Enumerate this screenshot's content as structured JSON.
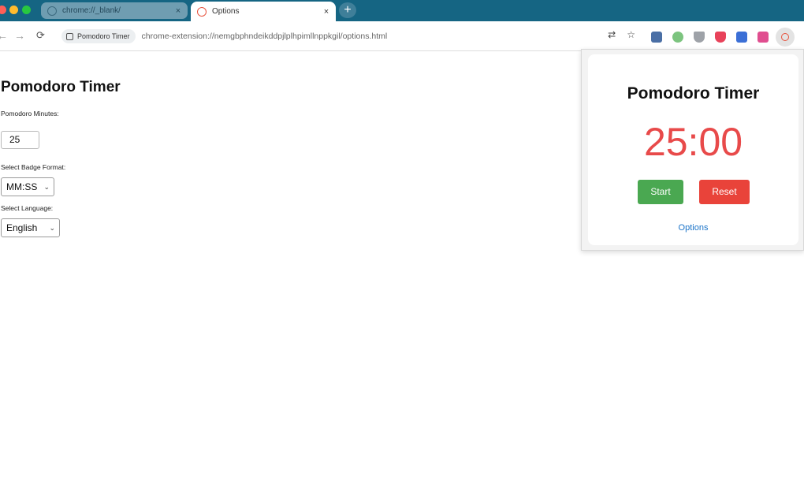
{
  "browser": {
    "tabs": [
      {
        "title": "chrome://_blank/",
        "active": false
      },
      {
        "title": "Options",
        "active": true
      }
    ],
    "new_tab": "+",
    "close_glyph": "×",
    "nav": {
      "back": "←",
      "forward": "→",
      "reload": "⟳"
    },
    "address": {
      "chip_label": "Pomodoro Timer",
      "url": "chrome-extension://nemgbphndeikddpjlplhpimllnppkgil/options.html"
    },
    "omnibox_icons": {
      "translate": "⇄",
      "bookmark": "☆"
    },
    "extension_icon_colors": [
      "#4a6fa5",
      "#7cc47f",
      "#9ea2a8",
      "#e8425a",
      "#3b6fd6",
      "#e04e8f"
    ]
  },
  "options_page": {
    "title": "Pomodoro Timer",
    "minutes_label": "Pomodoro Minutes:",
    "minutes_value": "25",
    "badge_format_label": "Select Badge Format:",
    "badge_format_value": "MM:SS",
    "language_label": "Select Language:",
    "language_value": "English",
    "caret": "⌄"
  },
  "popup": {
    "title": "Pomodoro Timer",
    "timer": "25:00",
    "start_label": "Start",
    "reset_label": "Reset",
    "options_link": "Options",
    "colors": {
      "timer": "#e84a4a",
      "start": "#4aa851",
      "reset": "#e9433a",
      "link": "#1a73c8"
    }
  }
}
